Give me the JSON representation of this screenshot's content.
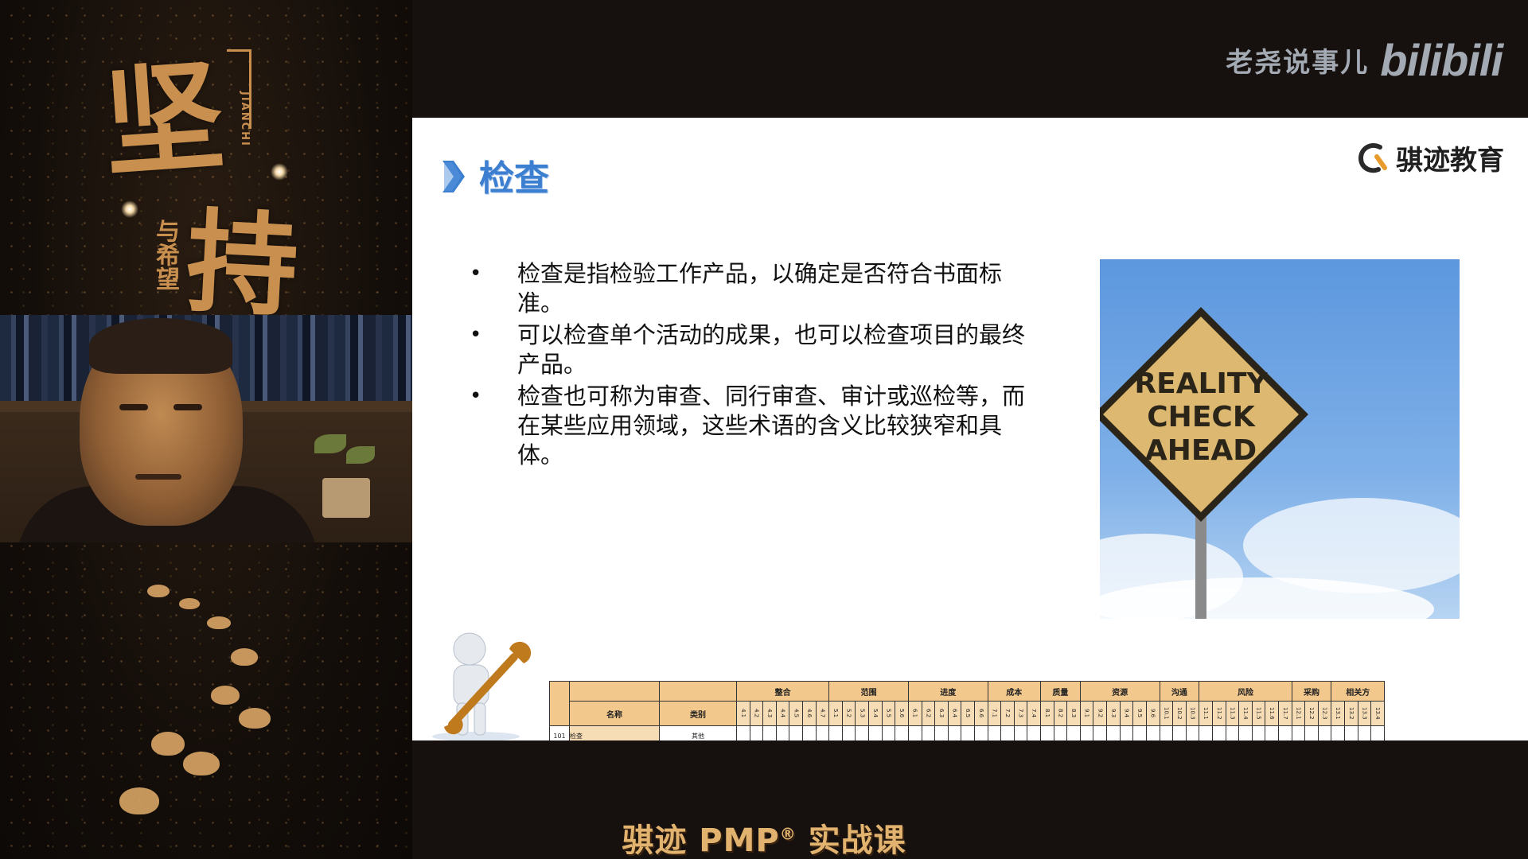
{
  "poster": {
    "title_chars": [
      "坚",
      "持"
    ],
    "romaji": "JIANCHI",
    "subtitle": "与希望"
  },
  "brand": {
    "channel": "老尧说事儿",
    "platform": "bilibili"
  },
  "slide": {
    "title": "检查",
    "company": "骐迹教育",
    "bullets": [
      "检查是指检验工作产品，以确定是否符合书面标准。",
      "可以检查单个活动的成果，也可以检查项目的最终产品。",
      "检查也可称为审查、同行审查、审计或巡检等，而在某些应用领域，这些术语的含义比较狭窄和具体。"
    ],
    "sign_lines": [
      "REALITY",
      "CHECK",
      "AHEAD"
    ],
    "table": {
      "groups": [
        "整合",
        "范围",
        "进度",
        "成本",
        "质量",
        "资源",
        "沟通",
        "风险",
        "采购",
        "相关方"
      ],
      "group_spans": [
        7,
        6,
        6,
        4,
        3,
        6,
        3,
        7,
        3,
        4
      ],
      "col_name": "名称",
      "col_category": "类别",
      "process_numbers": [
        "4.1",
        "4.2",
        "4.3",
        "4.4",
        "4.5",
        "4.6",
        "4.7",
        "5.1",
        "5.2",
        "5.3",
        "5.4",
        "5.5",
        "5.6",
        "6.1",
        "6.2",
        "6.3",
        "6.4",
        "6.5",
        "6.6",
        "7.1",
        "7.2",
        "7.3",
        "7.4",
        "8.1",
        "8.2",
        "8.3",
        "9.1",
        "9.2",
        "9.3",
        "9.4",
        "9.5",
        "9.6",
        "10.1",
        "10.2",
        "10.3",
        "11.1",
        "11.2",
        "11.3",
        "11.4",
        "11.5",
        "11.6",
        "11.7",
        "12.1",
        "12.2",
        "12.3",
        "13.1",
        "13.2",
        "13.3",
        "13.4"
      ],
      "row": {
        "id": "101",
        "name": "检查",
        "category": "其他"
      }
    }
  },
  "caption": {
    "text": "骐迹 PMP",
    "reg": "®",
    "suffix": " 实战课"
  },
  "colors": {
    "title_blue": "#3c7fd0",
    "poster_gold": "#c88f4f",
    "caption_gold": "#e2b36f",
    "table_header": "#f3c88d"
  }
}
